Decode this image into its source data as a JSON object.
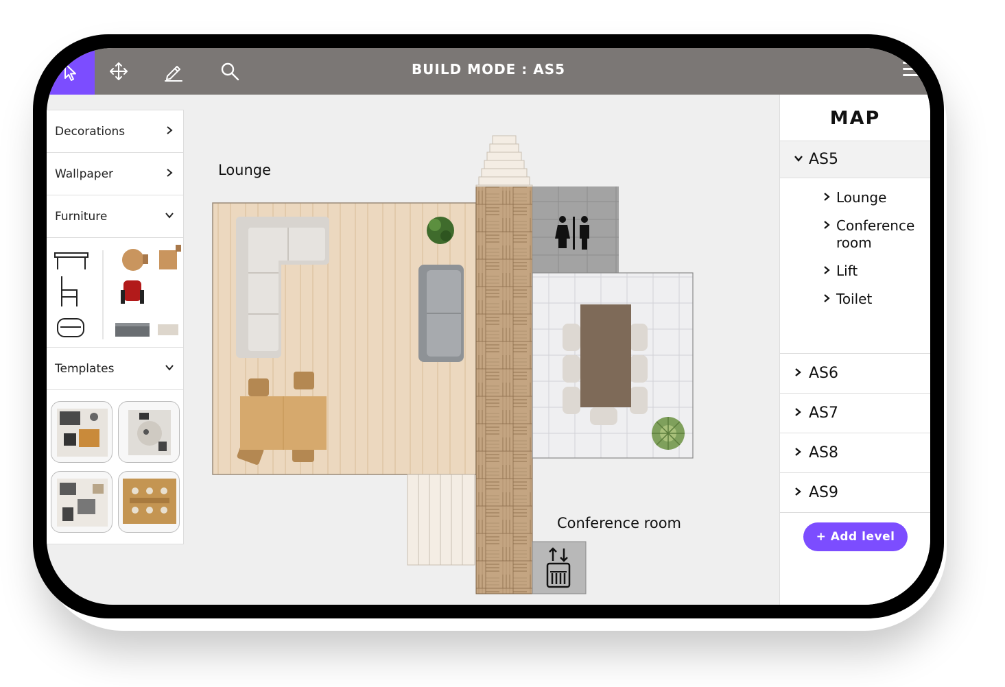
{
  "toolbar": {
    "title": "BUILD MODE : AS5",
    "tools": [
      {
        "icon": "pointer-icon",
        "active": true
      },
      {
        "icon": "move-icon",
        "active": false
      },
      {
        "icon": "pencil-icon",
        "active": false
      },
      {
        "icon": "search-icon",
        "active": false
      }
    ],
    "menu_icon": "hamburger-menu-icon"
  },
  "left_panel": {
    "sections": [
      {
        "label": "Decorations",
        "chevron": "›"
      },
      {
        "label": "Wallpaper",
        "chevron": "›"
      },
      {
        "label": "Furniture",
        "chevron": "⌄"
      },
      {
        "label": "Templates",
        "chevron": "⌄"
      }
    ]
  },
  "canvas": {
    "rooms": [
      {
        "label": "Lounge"
      },
      {
        "label": "Conference room"
      }
    ]
  },
  "map": {
    "title": "MAP",
    "levels": [
      {
        "label": "AS5",
        "expanded": true,
        "rooms": [
          "Lounge",
          "Conference room",
          "Lift",
          "Toilet"
        ]
      },
      {
        "label": "AS6"
      },
      {
        "label": "AS7"
      },
      {
        "label": "AS8"
      },
      {
        "label": "AS9"
      }
    ],
    "add_button": "+ Add level"
  },
  "colors": {
    "accent": "#7c4dff",
    "toolbar": "#7b7775"
  }
}
